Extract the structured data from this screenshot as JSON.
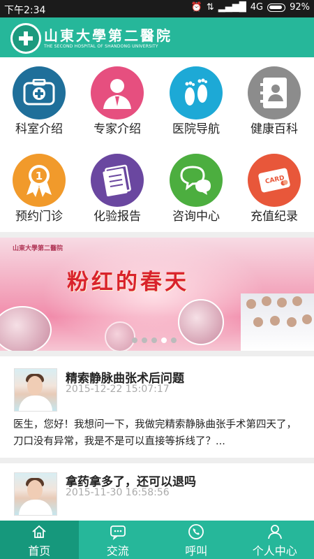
{
  "status_bar": {
    "time": "下午2:34",
    "network": "4G",
    "battery": "92%"
  },
  "header": {
    "title_cn": "山東大學第二醫院",
    "title_en": "THE SECOND HOSPITAL OF SHANDONG UNIVERSITY"
  },
  "grid": {
    "items": [
      {
        "label": "科室介绍",
        "icon": "medical-kit-icon",
        "color": "#1f6f9a"
      },
      {
        "label": "专家介绍",
        "icon": "doctor-icon",
        "color": "#e64f7f"
      },
      {
        "label": "医院导航",
        "icon": "footprints-icon",
        "color": "#1da9d6"
      },
      {
        "label": "健康百科",
        "icon": "contact-book-icon",
        "color": "#8c8c8c"
      },
      {
        "label": "预约门诊",
        "icon": "medal-icon",
        "color": "#f19a2b"
      },
      {
        "label": "化验报告",
        "icon": "report-icon",
        "color": "#6a47a0"
      },
      {
        "label": "咨询中心",
        "icon": "chat-bubbles-icon",
        "color": "#4cae3f"
      },
      {
        "label": "充值纪录",
        "icon": "card-icon",
        "color": "#e8573a"
      }
    ]
  },
  "banner": {
    "title": "粉红的春天",
    "logo_text": "山東大學第二醫院",
    "pages": 5,
    "active_page": 4
  },
  "posts": [
    {
      "title": "精索静脉曲张术后问题",
      "time": "2015-12-22 15:07:17",
      "body": "医生，您好！我想问一下，我做完精索静脉曲张手术第四天了，刀口没有异常，我是不是可以直接等拆线了？..."
    },
    {
      "title": "拿药拿多了，还可以退吗",
      "time": "2015-11-30 16:58:56"
    }
  ],
  "tabbar": {
    "tabs": [
      {
        "label": "首页",
        "icon": "home-icon",
        "active": true
      },
      {
        "label": "交流",
        "icon": "chat-icon",
        "active": false
      },
      {
        "label": "呼叫",
        "icon": "phone-icon",
        "active": false
      },
      {
        "label": "个人中心",
        "icon": "user-icon",
        "active": false
      }
    ]
  },
  "colors": {
    "brand": "#26b79a",
    "brand_dark": "#16987c",
    "status_bar": "#1b1b1b"
  }
}
